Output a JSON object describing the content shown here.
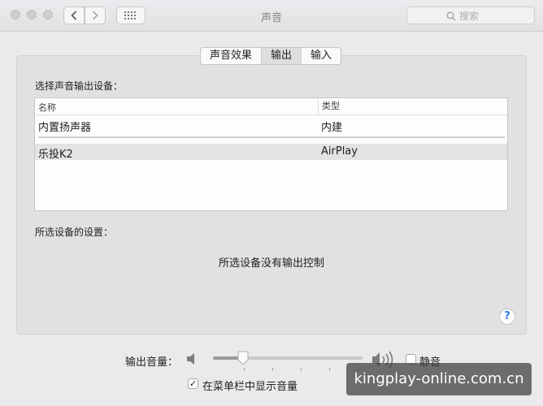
{
  "window": {
    "title": "声音"
  },
  "search": {
    "placeholder": "搜索"
  },
  "tabs": [
    {
      "label": "声音效果",
      "active": false
    },
    {
      "label": "输出",
      "active": true
    },
    {
      "label": "输入",
      "active": false
    }
  ],
  "output": {
    "section_label": "选择声音输出设备：",
    "columns": {
      "name": "名称",
      "type": "类型"
    },
    "devices": [
      {
        "name": "内置扬声器",
        "type": "内建"
      },
      {
        "name": "乐投K2",
        "type": "AirPlay",
        "selected": true
      }
    ]
  },
  "settings": {
    "label": "所选设备的设置：",
    "message": "所选设备没有输出控制"
  },
  "volume": {
    "label": "输出音量：",
    "level_fraction": 0.2,
    "mute_label": "静音",
    "mute_checked": false,
    "show_in_menubar_label": "在菜单栏中显示音量",
    "show_in_menubar_checked": true
  },
  "icons": {
    "back": "chevron-left-icon",
    "forward": "chevron-right-icon",
    "grid": "grid-icon",
    "search": "search-icon",
    "volume_low": "speaker-low-icon",
    "volume_high": "speaker-high-icon",
    "help": "help-icon"
  },
  "watermark": "kingplay-online.com.cn",
  "colors": {
    "accent": "#2f7ae5",
    "selected_row": "#e4e2e4"
  }
}
